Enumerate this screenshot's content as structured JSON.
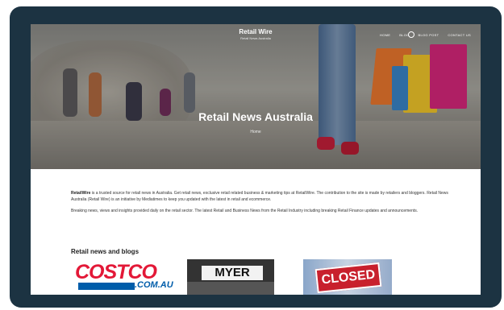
{
  "header": {
    "logo": "Retail Wire",
    "tagline": "Retail News Australia",
    "nav": [
      "HOME",
      "BLOG",
      "BLOG POST",
      "CONTACT US"
    ]
  },
  "hero": {
    "title": "Retail News Australia",
    "breadcrumb": "Home"
  },
  "content": {
    "intro_bold": "RetailWire",
    "intro_text": " is a trusted source for retail news in Australia. Get retail news, exclusive retail related business & marketing tips at RetailWire. The contribution to the site is made by retailers and bloggers. Retail News Australia (Retail Wire) is an initiative by Mediatimes to keep you updated with the latest in retail and ecommerce.",
    "para2": "Breaking news, views and insights provided daily on the retail sector. The latest Retail and Business News from the Retail Industry including breaking Retail Finance updates and announcements."
  },
  "section": {
    "title": "Retail news and blogs"
  },
  "thumbs": {
    "costco_word": "COSTCO",
    "costco_sub": ".COM.AU",
    "myer_word": "MYER",
    "closed_word": "CLOSED"
  },
  "colors": {
    "frame": "#1c3342",
    "costco_red": "#e31837",
    "costco_blue": "#005daa"
  }
}
